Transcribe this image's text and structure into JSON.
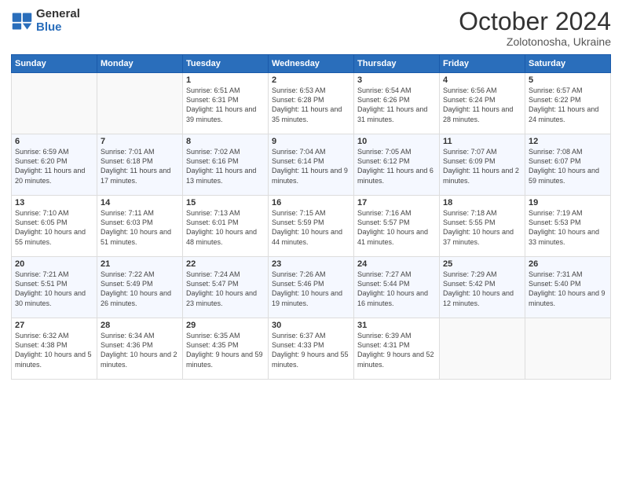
{
  "logo": {
    "general": "General",
    "blue": "Blue"
  },
  "header": {
    "month": "October 2024",
    "location": "Zolotonosha, Ukraine"
  },
  "days_of_week": [
    "Sunday",
    "Monday",
    "Tuesday",
    "Wednesday",
    "Thursday",
    "Friday",
    "Saturday"
  ],
  "weeks": [
    [
      {
        "day": "",
        "sunrise": "",
        "sunset": "",
        "daylight": ""
      },
      {
        "day": "",
        "sunrise": "",
        "sunset": "",
        "daylight": ""
      },
      {
        "day": "1",
        "sunrise": "Sunrise: 6:51 AM",
        "sunset": "Sunset: 6:31 PM",
        "daylight": "Daylight: 11 hours and 39 minutes."
      },
      {
        "day": "2",
        "sunrise": "Sunrise: 6:53 AM",
        "sunset": "Sunset: 6:28 PM",
        "daylight": "Daylight: 11 hours and 35 minutes."
      },
      {
        "day": "3",
        "sunrise": "Sunrise: 6:54 AM",
        "sunset": "Sunset: 6:26 PM",
        "daylight": "Daylight: 11 hours and 31 minutes."
      },
      {
        "day": "4",
        "sunrise": "Sunrise: 6:56 AM",
        "sunset": "Sunset: 6:24 PM",
        "daylight": "Daylight: 11 hours and 28 minutes."
      },
      {
        "day": "5",
        "sunrise": "Sunrise: 6:57 AM",
        "sunset": "Sunset: 6:22 PM",
        "daylight": "Daylight: 11 hours and 24 minutes."
      }
    ],
    [
      {
        "day": "6",
        "sunrise": "Sunrise: 6:59 AM",
        "sunset": "Sunset: 6:20 PM",
        "daylight": "Daylight: 11 hours and 20 minutes."
      },
      {
        "day": "7",
        "sunrise": "Sunrise: 7:01 AM",
        "sunset": "Sunset: 6:18 PM",
        "daylight": "Daylight: 11 hours and 17 minutes."
      },
      {
        "day": "8",
        "sunrise": "Sunrise: 7:02 AM",
        "sunset": "Sunset: 6:16 PM",
        "daylight": "Daylight: 11 hours and 13 minutes."
      },
      {
        "day": "9",
        "sunrise": "Sunrise: 7:04 AM",
        "sunset": "Sunset: 6:14 PM",
        "daylight": "Daylight: 11 hours and 9 minutes."
      },
      {
        "day": "10",
        "sunrise": "Sunrise: 7:05 AM",
        "sunset": "Sunset: 6:12 PM",
        "daylight": "Daylight: 11 hours and 6 minutes."
      },
      {
        "day": "11",
        "sunrise": "Sunrise: 7:07 AM",
        "sunset": "Sunset: 6:09 PM",
        "daylight": "Daylight: 11 hours and 2 minutes."
      },
      {
        "day": "12",
        "sunrise": "Sunrise: 7:08 AM",
        "sunset": "Sunset: 6:07 PM",
        "daylight": "Daylight: 10 hours and 59 minutes."
      }
    ],
    [
      {
        "day": "13",
        "sunrise": "Sunrise: 7:10 AM",
        "sunset": "Sunset: 6:05 PM",
        "daylight": "Daylight: 10 hours and 55 minutes."
      },
      {
        "day": "14",
        "sunrise": "Sunrise: 7:11 AM",
        "sunset": "Sunset: 6:03 PM",
        "daylight": "Daylight: 10 hours and 51 minutes."
      },
      {
        "day": "15",
        "sunrise": "Sunrise: 7:13 AM",
        "sunset": "Sunset: 6:01 PM",
        "daylight": "Daylight: 10 hours and 48 minutes."
      },
      {
        "day": "16",
        "sunrise": "Sunrise: 7:15 AM",
        "sunset": "Sunset: 5:59 PM",
        "daylight": "Daylight: 10 hours and 44 minutes."
      },
      {
        "day": "17",
        "sunrise": "Sunrise: 7:16 AM",
        "sunset": "Sunset: 5:57 PM",
        "daylight": "Daylight: 10 hours and 41 minutes."
      },
      {
        "day": "18",
        "sunrise": "Sunrise: 7:18 AM",
        "sunset": "Sunset: 5:55 PM",
        "daylight": "Daylight: 10 hours and 37 minutes."
      },
      {
        "day": "19",
        "sunrise": "Sunrise: 7:19 AM",
        "sunset": "Sunset: 5:53 PM",
        "daylight": "Daylight: 10 hours and 33 minutes."
      }
    ],
    [
      {
        "day": "20",
        "sunrise": "Sunrise: 7:21 AM",
        "sunset": "Sunset: 5:51 PM",
        "daylight": "Daylight: 10 hours and 30 minutes."
      },
      {
        "day": "21",
        "sunrise": "Sunrise: 7:22 AM",
        "sunset": "Sunset: 5:49 PM",
        "daylight": "Daylight: 10 hours and 26 minutes."
      },
      {
        "day": "22",
        "sunrise": "Sunrise: 7:24 AM",
        "sunset": "Sunset: 5:47 PM",
        "daylight": "Daylight: 10 hours and 23 minutes."
      },
      {
        "day": "23",
        "sunrise": "Sunrise: 7:26 AM",
        "sunset": "Sunset: 5:46 PM",
        "daylight": "Daylight: 10 hours and 19 minutes."
      },
      {
        "day": "24",
        "sunrise": "Sunrise: 7:27 AM",
        "sunset": "Sunset: 5:44 PM",
        "daylight": "Daylight: 10 hours and 16 minutes."
      },
      {
        "day": "25",
        "sunrise": "Sunrise: 7:29 AM",
        "sunset": "Sunset: 5:42 PM",
        "daylight": "Daylight: 10 hours and 12 minutes."
      },
      {
        "day": "26",
        "sunrise": "Sunrise: 7:31 AM",
        "sunset": "Sunset: 5:40 PM",
        "daylight": "Daylight: 10 hours and 9 minutes."
      }
    ],
    [
      {
        "day": "27",
        "sunrise": "Sunrise: 6:32 AM",
        "sunset": "Sunset: 4:38 PM",
        "daylight": "Daylight: 10 hours and 5 minutes."
      },
      {
        "day": "28",
        "sunrise": "Sunrise: 6:34 AM",
        "sunset": "Sunset: 4:36 PM",
        "daylight": "Daylight: 10 hours and 2 minutes."
      },
      {
        "day": "29",
        "sunrise": "Sunrise: 6:35 AM",
        "sunset": "Sunset: 4:35 PM",
        "daylight": "Daylight: 9 hours and 59 minutes."
      },
      {
        "day": "30",
        "sunrise": "Sunrise: 6:37 AM",
        "sunset": "Sunset: 4:33 PM",
        "daylight": "Daylight: 9 hours and 55 minutes."
      },
      {
        "day": "31",
        "sunrise": "Sunrise: 6:39 AM",
        "sunset": "Sunset: 4:31 PM",
        "daylight": "Daylight: 9 hours and 52 minutes."
      },
      {
        "day": "",
        "sunrise": "",
        "sunset": "",
        "daylight": ""
      },
      {
        "day": "",
        "sunrise": "",
        "sunset": "",
        "daylight": ""
      }
    ]
  ]
}
